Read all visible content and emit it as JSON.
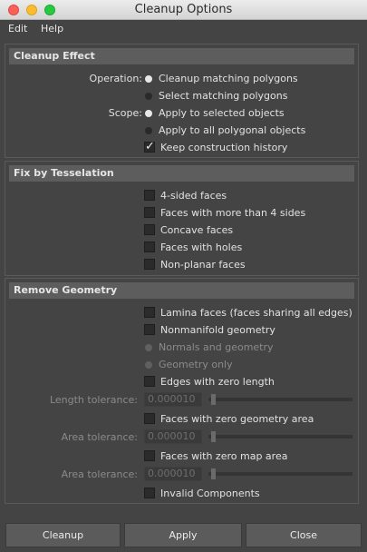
{
  "window": {
    "title": "Cleanup Options"
  },
  "menu": {
    "edit": "Edit",
    "help": "Help"
  },
  "cleanup_effect": {
    "header": "Cleanup Effect",
    "operation_label": "Operation:",
    "operation_options": [
      "Cleanup matching polygons",
      "Select matching polygons"
    ],
    "operation_selected": 0,
    "scope_label": "Scope:",
    "scope_options": [
      "Apply to selected objects",
      "Apply to all polygonal objects"
    ],
    "scope_selected": 0,
    "keep_history": {
      "label": "Keep construction history",
      "checked": true
    }
  },
  "fix_tesselation": {
    "header": "Fix by Tesselation",
    "options": [
      {
        "label": "4-sided faces",
        "checked": false
      },
      {
        "label": "Faces with more than 4 sides",
        "checked": false
      },
      {
        "label": "Concave faces",
        "checked": false
      },
      {
        "label": "Faces with holes",
        "checked": false
      },
      {
        "label": "Non-planar faces",
        "checked": false
      }
    ]
  },
  "remove_geometry": {
    "header": "Remove Geometry",
    "lamina": {
      "label": "Lamina faces (faces sharing all edges)",
      "checked": false
    },
    "nonmanifold": {
      "label": "Nonmanifold geometry",
      "checked": false
    },
    "nonmanifold_options": [
      "Normals and geometry",
      "Geometry only"
    ],
    "nonmanifold_selected": 0,
    "zero_edges": {
      "label": "Edges with zero length",
      "checked": false
    },
    "length_tolerance": {
      "label": "Length tolerance:",
      "value": "0.000010"
    },
    "zero_geom_area": {
      "label": "Faces with zero geometry area",
      "checked": false
    },
    "area_tolerance_1": {
      "label": "Area tolerance:",
      "value": "0.000010"
    },
    "zero_map_area": {
      "label": "Faces with zero map area",
      "checked": false
    },
    "area_tolerance_2": {
      "label": "Area tolerance:",
      "value": "0.000010"
    },
    "invalid": {
      "label": "Invalid Components",
      "checked": false
    }
  },
  "buttons": {
    "cleanup": "Cleanup",
    "apply": "Apply",
    "close": "Close"
  }
}
